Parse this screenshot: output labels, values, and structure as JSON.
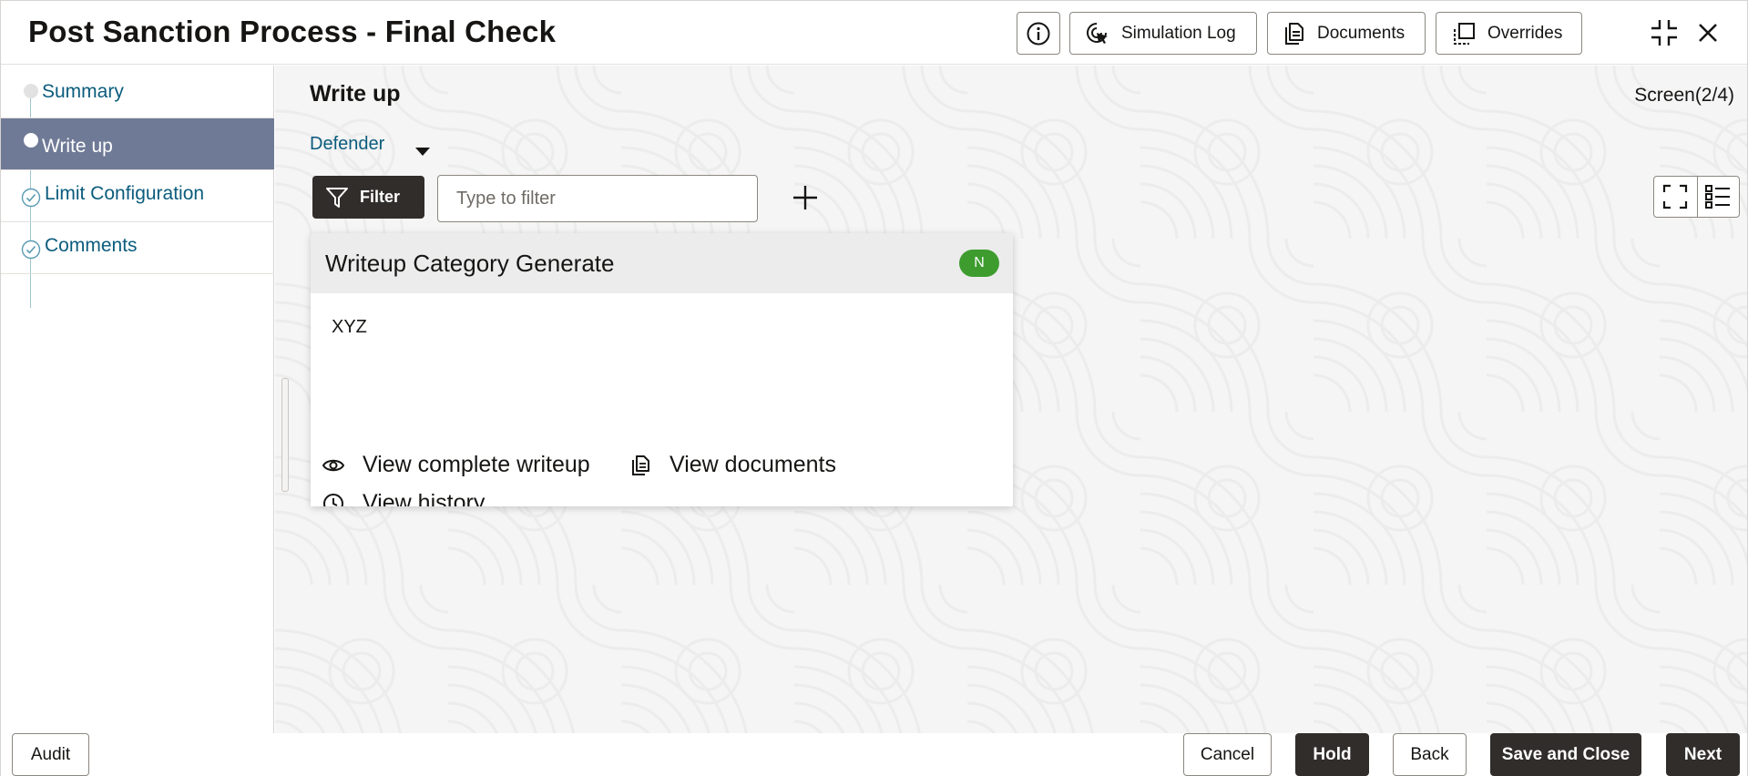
{
  "header": {
    "title": "Post Sanction Process - Final Check",
    "buttons": {
      "simulation_log": "Simulation Log",
      "documents": "Documents",
      "overrides": "Overrides"
    }
  },
  "sidebar": {
    "steps": [
      {
        "label": "Summary",
        "state": "visited"
      },
      {
        "label": "Write up",
        "state": "active"
      },
      {
        "label": "Limit Configuration",
        "state": "completed"
      },
      {
        "label": "Comments",
        "state": "completed"
      }
    ]
  },
  "main": {
    "page_title": "Write up",
    "screen_count": "Screen(2/4)",
    "defender_label": "Defender",
    "filter_button": "Filter",
    "filter_placeholder": "Type to filter",
    "card": {
      "title": "Writeup Category Generate",
      "badge": "N",
      "body": "XYZ",
      "actions": {
        "view_complete": "View complete writeup",
        "view_documents": "View documents",
        "view_history": "View history"
      }
    }
  },
  "footer": {
    "audit": "Audit",
    "cancel": "Cancel",
    "hold": "Hold",
    "back": "Back",
    "save_and_close": "Save and Close",
    "next": "Next"
  },
  "colors": {
    "accent_link": "#0b5c7d",
    "active_step_bg": "#6f7a96",
    "primary_button": "#312d2a",
    "badge_green": "#3e9c2f"
  }
}
